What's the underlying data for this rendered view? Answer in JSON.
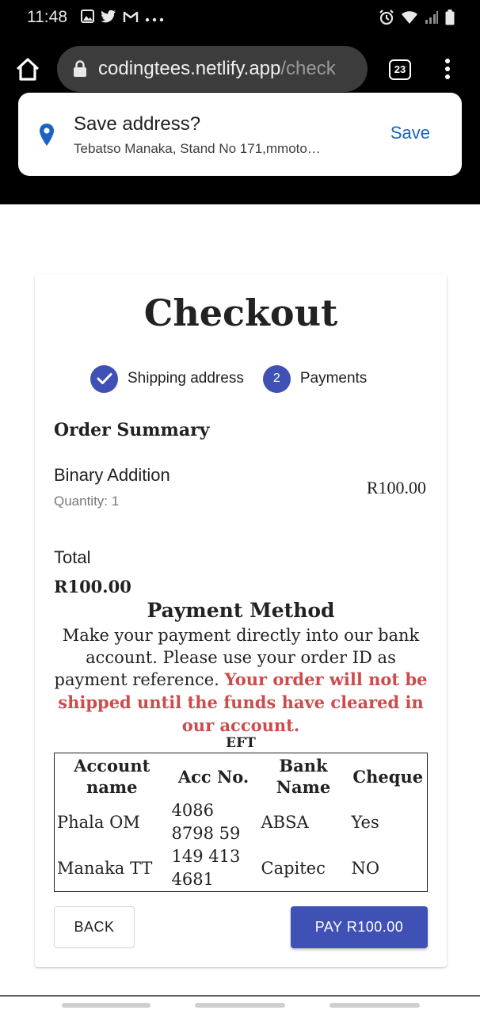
{
  "status_bar": {
    "time": "11:48",
    "left_icons": [
      "image-icon",
      "twitter-icon",
      "gmail-icon",
      "more-notifications-icon"
    ],
    "right_icons": [
      "alarm-icon",
      "wifi-icon",
      "signal-icon",
      "battery-icon"
    ]
  },
  "browser": {
    "url_host": "codingtees.netlify.app",
    "url_path": "/check",
    "tab_count": "23"
  },
  "save_prompt": {
    "title": "Save address?",
    "subtitle": "Tebatso Manaka, Stand No 171,mmoto…",
    "action_label": "Save"
  },
  "checkout": {
    "title": "Checkout",
    "steps": [
      {
        "label": "Shipping address",
        "state": "done"
      },
      {
        "label": "Payments",
        "number": "2",
        "state": "active"
      }
    ],
    "order_summary": {
      "heading": "Order Summary",
      "item_name": "Binary Addition",
      "item_quantity": "Quantity: 1",
      "item_price": "R100.00",
      "total_label": "Total",
      "total_value": "R100.00"
    },
    "payment_method": {
      "heading": "Payment Method",
      "text": "Make your payment directly into our bank account. Please use your order ID as payment reference.",
      "warning": "Your order will not be shipped until the funds have cleared in our account.",
      "table_caption": "EFT",
      "columns": [
        "Account name",
        "Acc No.",
        "Bank Name",
        "Cheque"
      ],
      "rows": [
        [
          "Phala OM",
          "4086 8798 59",
          "ABSA",
          "Yes"
        ],
        [
          "Manaka TT",
          "149 413 4681",
          "Capitec",
          "NO"
        ]
      ]
    },
    "back_label": "BACK",
    "pay_label": "PAY R100.00"
  },
  "colors": {
    "primary": "#3f51b5",
    "warning": "#cc4b4b",
    "link": "#1a63c4"
  }
}
